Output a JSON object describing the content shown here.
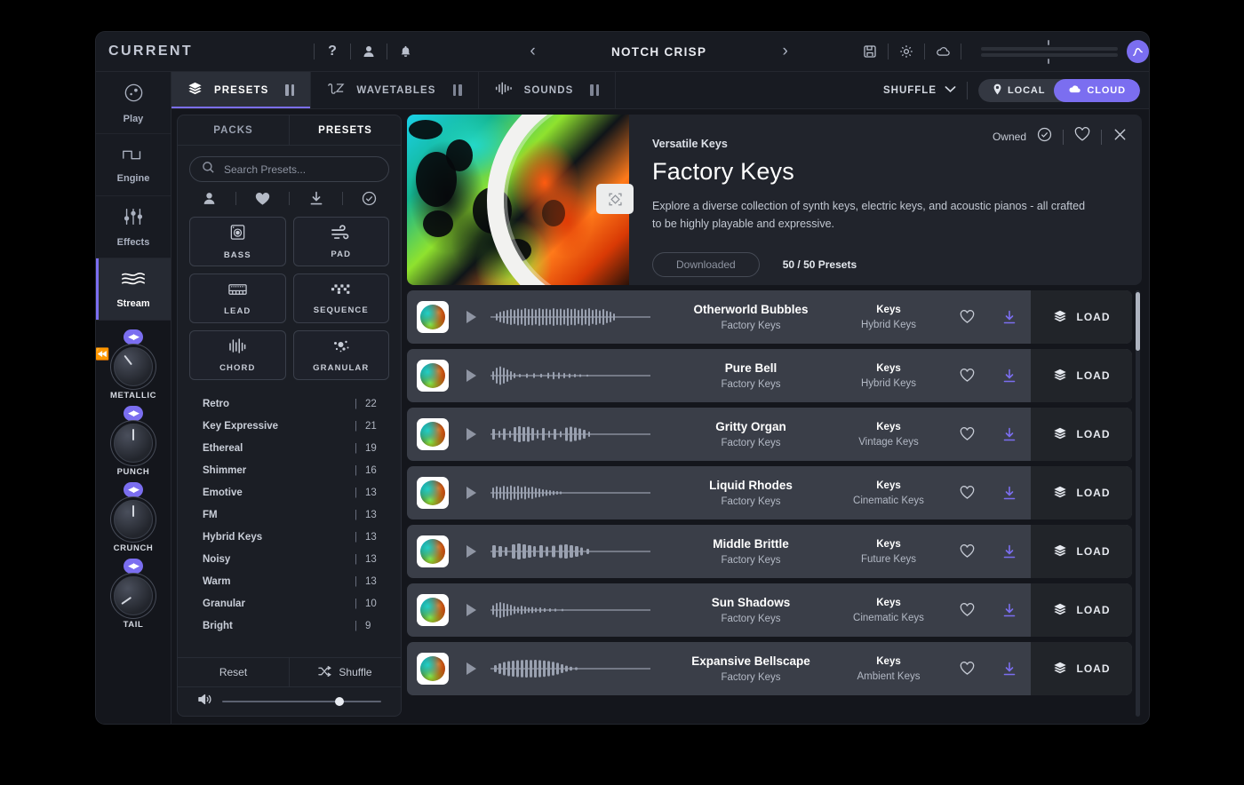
{
  "topbar": {
    "logo": "CURRENT",
    "help_icon": "?",
    "account_icon": "user-icon",
    "bell_icon": "bell-icon",
    "prev_label": "‹",
    "preset_name": "NOTCH CRISP",
    "next_label": "›",
    "save_icon": "save-icon",
    "settings_icon": "gear-icon",
    "cloud_icon": "cloud-icon"
  },
  "rail": {
    "items": [
      {
        "label": "Play",
        "icon": "play-face-icon",
        "active": false
      },
      {
        "label": "Engine",
        "icon": "square-wave-icon",
        "active": false
      },
      {
        "label": "Effects",
        "icon": "sliders-icon",
        "active": false
      },
      {
        "label": "Stream",
        "icon": "stream-icon",
        "active": true
      }
    ],
    "knobs": [
      {
        "label": "METALLIC",
        "modulated": true
      },
      {
        "label": "PUNCH",
        "modulated": false
      },
      {
        "label": "CRUNCH",
        "modulated": false
      },
      {
        "label": "TAIL",
        "modulated": false
      }
    ]
  },
  "tabs": {
    "items": [
      {
        "label": "PRESETS",
        "icon": "layers-icon",
        "active": true
      },
      {
        "label": "WAVETABLES",
        "icon": "waveform-icon",
        "active": false
      },
      {
        "label": "SOUNDS",
        "icon": "bars-icon",
        "active": false
      }
    ],
    "shuffle_label": "SHUFFLE",
    "local_label": "LOCAL",
    "cloud_label": "CLOUD"
  },
  "browser": {
    "packs_tab": "PACKS",
    "presets_tab": "PRESETS",
    "search_placeholder": "Search Presets...",
    "search_value": "",
    "filter_icons": [
      "user-icon",
      "heart-filled-icon",
      "download-icon",
      "check-circle-icon"
    ],
    "categories": [
      {
        "label": "BASS",
        "icon": "speaker-icon"
      },
      {
        "label": "PAD",
        "icon": "wind-icon"
      },
      {
        "label": "LEAD",
        "icon": "keyboard-icon"
      },
      {
        "label": "SEQUENCE",
        "icon": "sequence-icon"
      },
      {
        "label": "CHORD",
        "icon": "chord-icon"
      },
      {
        "label": "GRANULAR",
        "icon": "granular-icon"
      }
    ],
    "tags": [
      {
        "name": "Retro",
        "count": "22"
      },
      {
        "name": "Key Expressive",
        "count": "21"
      },
      {
        "name": "Ethereal",
        "count": "19"
      },
      {
        "name": "Shimmer",
        "count": "16"
      },
      {
        "name": "Emotive",
        "count": "13"
      },
      {
        "name": "FM",
        "count": "13"
      },
      {
        "name": "Hybrid Keys",
        "count": "13"
      },
      {
        "name": "Noisy",
        "count": "13"
      },
      {
        "name": "Warm",
        "count": "13"
      },
      {
        "name": "Granular",
        "count": "10"
      },
      {
        "name": "Bright",
        "count": "9"
      }
    ],
    "reset_label": "Reset",
    "shuffle_label": "Shuffle",
    "volume_icon": "speaker-wave-icon",
    "volume_percent": 71
  },
  "hero": {
    "subtitle": "Versatile Keys",
    "title": "Factory Keys",
    "description": "Explore a diverse collection of synth keys, electric keys, and acoustic pianos - all crafted to be highly playable and expressive.",
    "download_label": "Downloaded",
    "preset_count": "50 / 50 Presets",
    "owned_label": "Owned",
    "owned_icon": "check-circle-icon",
    "favorite_icon": "heart-outline-icon",
    "close_icon": "close-icon",
    "artwork": "paint-swirl-artwork"
  },
  "presets": {
    "load_label": "LOAD",
    "rows": [
      {
        "name": "Otherworld Bubbles",
        "pack": "Factory Keys",
        "category": "Keys",
        "subcategory": "Hybrid Keys"
      },
      {
        "name": "Pure Bell",
        "pack": "Factory Keys",
        "category": "Keys",
        "subcategory": "Hybrid Keys"
      },
      {
        "name": "Gritty Organ",
        "pack": "Factory Keys",
        "category": "Keys",
        "subcategory": "Vintage Keys"
      },
      {
        "name": "Liquid Rhodes",
        "pack": "Factory Keys",
        "category": "Keys",
        "subcategory": "Cinematic Keys"
      },
      {
        "name": "Middle Brittle",
        "pack": "Factory Keys",
        "category": "Keys",
        "subcategory": "Future Keys"
      },
      {
        "name": "Sun Shadows",
        "pack": "Factory Keys",
        "category": "Keys",
        "subcategory": "Cinematic Keys"
      },
      {
        "name": "Expansive Bellscape",
        "pack": "Factory Keys",
        "category": "Keys",
        "subcategory": "Ambient Keys"
      }
    ]
  },
  "colors": {
    "accent": "#7b6ef0",
    "app_bg": "#14161c",
    "panel_bg": "#1b1e25",
    "row_bg": "#3a3e48",
    "text": "#ffffff"
  }
}
